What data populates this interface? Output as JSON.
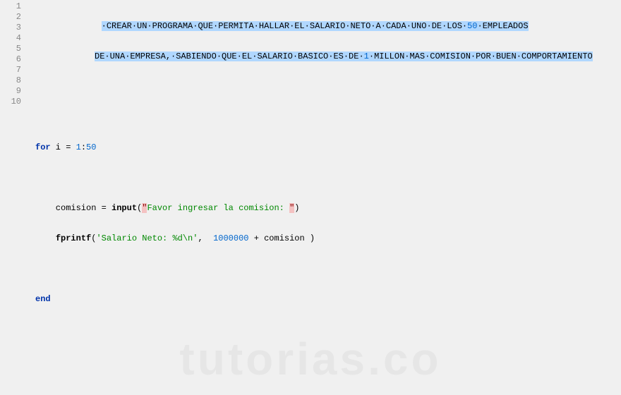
{
  "gutter": {
    "lines": [
      "1",
      "2",
      "3",
      "4",
      "5",
      "6",
      "7",
      "8",
      "9",
      "10"
    ]
  },
  "code": {
    "ln1_pre": "             ",
    "ln1_sel_dotted": "·CREAR·UN·PROGRAMA·QUE·PERMITA·HALLAR·EL·SALARIO·NETO·A·CADA·UNO·DE·LOS·",
    "ln1_sel_num": "50",
    "ln1_sel_tail": "·EMPLEADOS",
    "ln2_sel_dotted": "DE·UNA·EMPRESA,·SABIENDO·QUE·EL·SALARIO·BASICO·ES·DE·",
    "ln2_sel_num": "1",
    "ln2_sel_tail": "·MILLON·MAS·COMISION·POR·BUEN·COMPORTAMIENTO",
    "ln5_for": "for",
    "ln5_rest1": " i = ",
    "ln5_num1": "1",
    "ln5_colon": ":",
    "ln5_num2": "50",
    "ln7_var": "    comision = ",
    "ln7_input": "input",
    "ln7_open": "(",
    "ln7_q1": "\"",
    "ln7_str": "Favor ingresar la comision: ",
    "ln7_q2": "\"",
    "ln7_close": ")",
    "ln8_indent": "    ",
    "ln8_fprintf": "fprintf",
    "ln8_open": "(",
    "ln8_str": "'Salario Neto: %d\\n'",
    "ln8_comma": ",  ",
    "ln8_num": "1000000",
    "ln8_rest": " + comision )",
    "ln10_end": "end"
  },
  "watermark": "tutorias.co"
}
